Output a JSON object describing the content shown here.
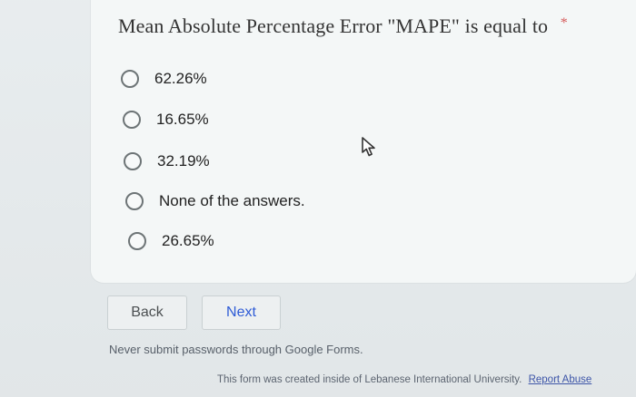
{
  "question": {
    "title": "Mean Absolute Percentage Error \"MAPE\" is equal to",
    "required_marker": "*"
  },
  "options": [
    {
      "label": "62.26%"
    },
    {
      "label": "16.65%"
    },
    {
      "label": "32.19%"
    },
    {
      "label": "None of the answers."
    },
    {
      "label": "26.65%"
    }
  ],
  "buttons": {
    "back": "Back",
    "next": "Next"
  },
  "footer": {
    "warning": "Never submit passwords through Google Forms.",
    "created_inside": "This form was created inside of Lebanese International University.",
    "report_abuse": "Report Abuse"
  },
  "icons": {
    "radio": "radio-button-icon",
    "cursor": "mouse-pointer-icon"
  },
  "colors": {
    "background": "#e6ebed",
    "card": "#f4f7f7",
    "next_text": "#2e5bd6",
    "required_star": "#d65b5b"
  }
}
